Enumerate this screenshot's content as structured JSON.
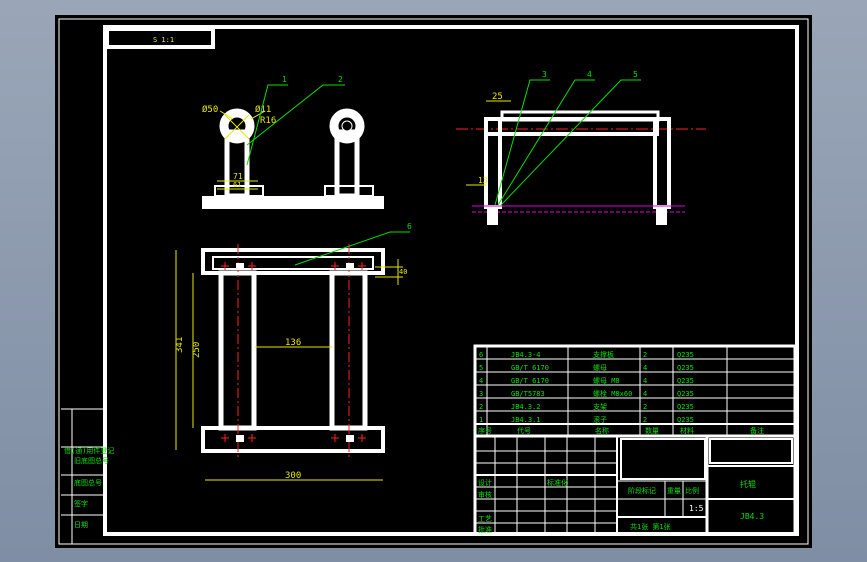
{
  "title_box": {
    "text": "S 1:1"
  },
  "leaders": [
    "1",
    "2",
    "3",
    "4",
    "5",
    "6"
  ],
  "dims": {
    "phi50": "Ø50",
    "phi11": "Ø11",
    "r16": "R16",
    "d71": "71",
    "d61": "61",
    "d25": "25",
    "d13": "13",
    "d136": "136",
    "d341": "341",
    "d250": "250",
    "d300": "300",
    "d40": "40"
  },
  "bom": [
    {
      "no": "6",
      "code": "JB4.3-4",
      "name": "支撑板",
      "qty": "2",
      "mat": "Q235"
    },
    {
      "no": "5",
      "code": "GB/T 6170",
      "name": "螺母",
      "qty": "4",
      "mat": "Q235"
    },
    {
      "no": "4",
      "code": "GB/T 6170",
      "name": "螺母 M8",
      "qty": "4",
      "mat": "Q235"
    },
    {
      "no": "3",
      "code": "GB/T5783",
      "name": "螺栓 M8x60",
      "qty": "4",
      "mat": "Q235"
    },
    {
      "no": "2",
      "code": "JB4.3.2",
      "name": "支架",
      "qty": "2",
      "mat": "Q235"
    },
    {
      "no": "1",
      "code": "JB4.3.1",
      "name": "滚子",
      "qty": "2",
      "mat": "Q235"
    }
  ],
  "bom_header": {
    "no": "序号",
    "code": "代号",
    "name": "名称",
    "qty": "数量",
    "mat": "材料",
    "note": "备注"
  },
  "title_block": {
    "part_name": "托辊",
    "drawing_no": "JB4.3",
    "scale": "1:5",
    "sheet": "共1张 第1张",
    "stage_label": "阶段标记",
    "weight_label": "重量",
    "scale_label": "比例",
    "design": "设计",
    "check": "审核",
    "process": "工艺",
    "approve": "批准",
    "std": "标准化"
  },
  "left_strip": [
    "借(通)用件登记",
    "旧底图总号",
    "底图总号",
    "签字",
    "日期"
  ]
}
